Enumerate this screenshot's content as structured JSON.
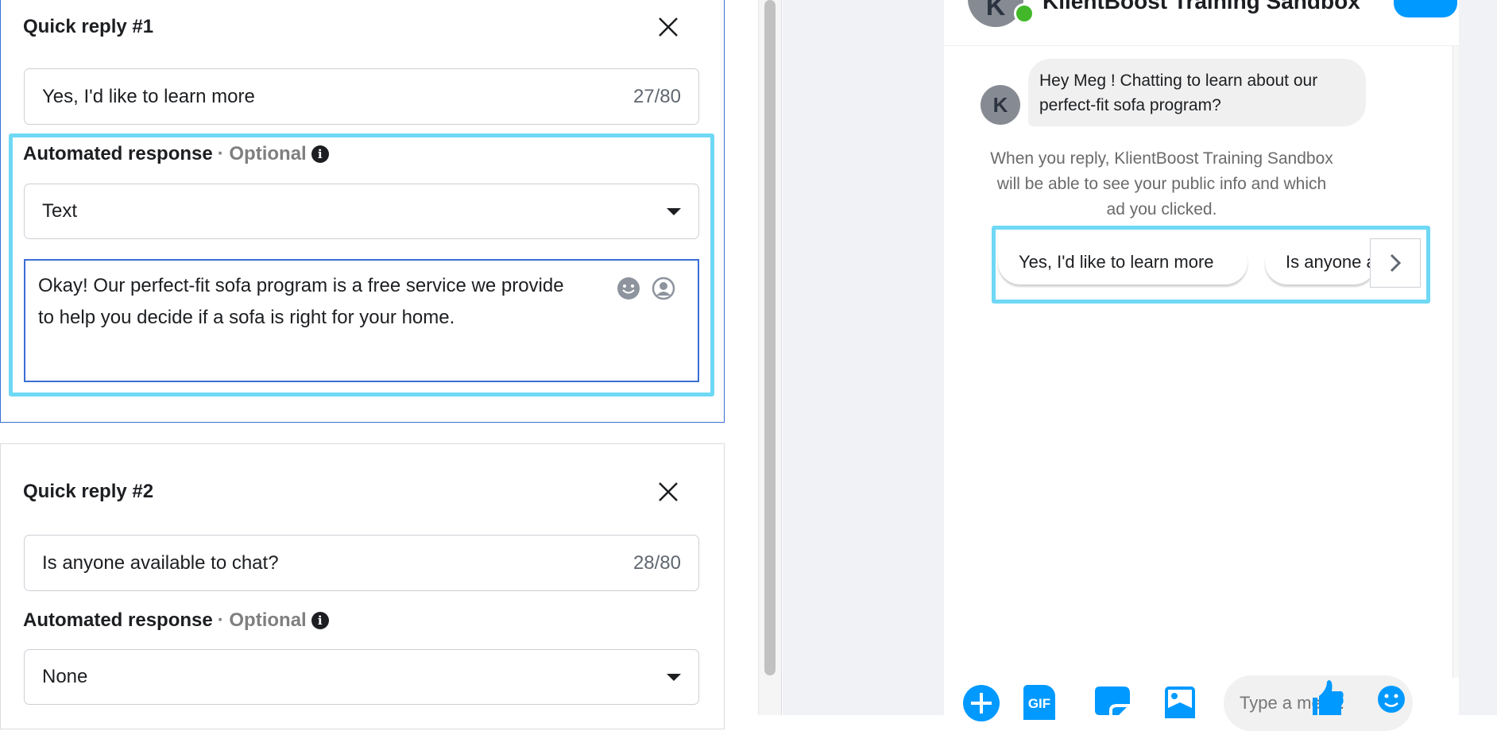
{
  "quick_replies": [
    {
      "title": "Quick reply #1",
      "text": "Yes, I'd like to learn more",
      "count": "27/80",
      "response_label": "Automated response",
      "optional": "· Optional",
      "response_type": "Text",
      "response_text": "Okay! Our perfect-fit sofa program is a free service we provide to help you decide if a sofa is right for your home."
    },
    {
      "title": "Quick reply #2",
      "text": "Is anyone available to chat?",
      "count": "28/80",
      "response_label": "Automated response",
      "optional": "· Optional",
      "response_type": "None"
    }
  ],
  "preview": {
    "page_name": "KlientBoost Training Sandbox",
    "avatar_letter": "K",
    "message": "Hey Meg ! Chatting to learn about our perfect-fit sofa program?",
    "notice": "When you reply, KlientBoost Training Sandbox will be able to see your public info and which ad you clicked.",
    "quick_buttons": [
      "Yes, I'd like to learn more",
      "Is anyone a"
    ],
    "composer_placeholder": "Type a mes...",
    "gif_label": "GIF"
  },
  "colors": {
    "accent": "#0099ff",
    "highlight": "#6fd8f5",
    "focus": "#3b6fd4",
    "online": "#42b72a"
  }
}
